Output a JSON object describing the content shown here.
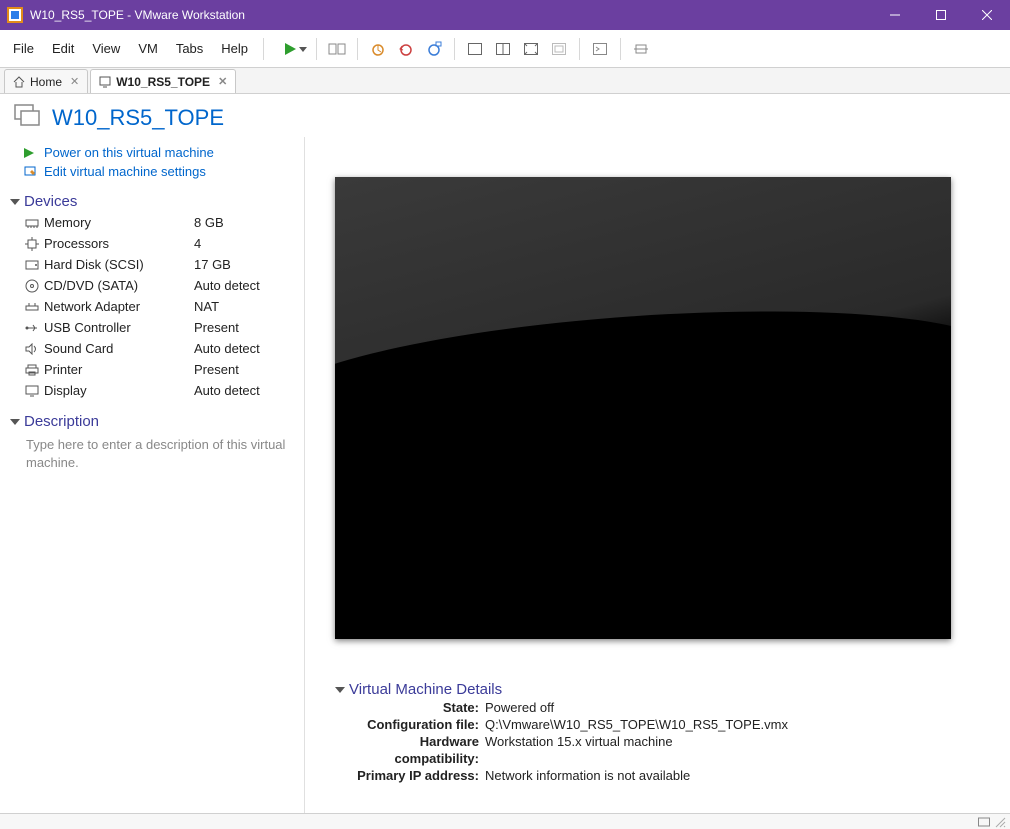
{
  "window": {
    "title": "W10_RS5_TOPE - VMware Workstation"
  },
  "menubar": {
    "items": [
      "File",
      "Edit",
      "View",
      "VM",
      "Tabs",
      "Help"
    ]
  },
  "tabs": [
    {
      "label": "Home",
      "active": false
    },
    {
      "label": "W10_RS5_TOPE",
      "active": true
    }
  ],
  "vm": {
    "name": "W10_RS5_TOPE"
  },
  "actions": {
    "power_on": "Power on this virtual machine",
    "edit_settings": "Edit virtual machine settings"
  },
  "sections": {
    "devices": "Devices",
    "description": "Description",
    "vm_details": "Virtual Machine Details"
  },
  "devices": [
    {
      "name": "Memory",
      "value": "8 GB",
      "icon": "memory"
    },
    {
      "name": "Processors",
      "value": "4",
      "icon": "cpu"
    },
    {
      "name": "Hard Disk (SCSI)",
      "value": "17 GB",
      "icon": "hdd"
    },
    {
      "name": "CD/DVD (SATA)",
      "value": "Auto detect",
      "icon": "cd"
    },
    {
      "name": "Network Adapter",
      "value": "NAT",
      "icon": "net"
    },
    {
      "name": "USB Controller",
      "value": "Present",
      "icon": "usb"
    },
    {
      "name": "Sound Card",
      "value": "Auto detect",
      "icon": "sound"
    },
    {
      "name": "Printer",
      "value": "Present",
      "icon": "printer"
    },
    {
      "name": "Display",
      "value": "Auto detect",
      "icon": "display"
    }
  ],
  "description": {
    "placeholder": "Type here to enter a description of this virtual machine."
  },
  "vm_details": {
    "rows": [
      {
        "label": "State:",
        "value": "Powered off"
      },
      {
        "label": "Configuration file:",
        "value": "Q:\\Vmware\\W10_RS5_TOPE\\W10_RS5_TOPE.vmx"
      },
      {
        "label": "Hardware compatibility:",
        "value": "Workstation 15.x virtual machine"
      },
      {
        "label": "Primary IP address:",
        "value": "Network information is not available"
      }
    ]
  }
}
